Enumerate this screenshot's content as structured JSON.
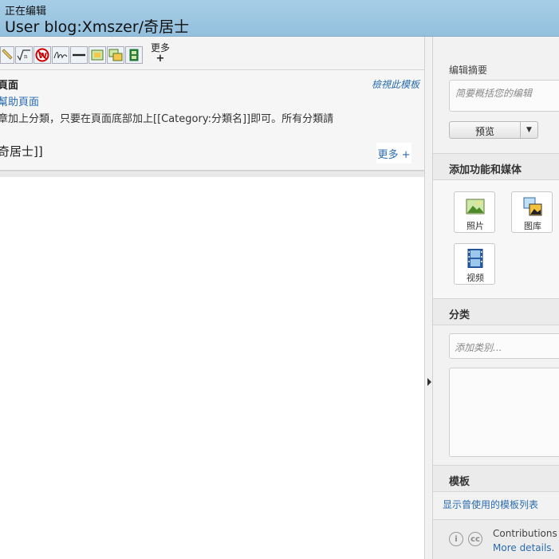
{
  "header": {
    "status": "正在编辑",
    "title": "User blog:Xmszer/奇居士"
  },
  "toolbar": {
    "buttons": [
      "pencil-icon",
      "math-formula-icon",
      "no-wiki-icon",
      "signature-icon",
      "horizontal-line-icon",
      "insert-image-icon",
      "insert-gallery-icon",
      "insert-video-icon"
    ],
    "more_label": "更多",
    "more_plus": "+"
  },
  "notice": {
    "title": "頁面",
    "help_link": "幫助頁面",
    "view_template": "檢視此模板",
    "text": "章加上分類，只要在頁面底部加上[[Category:分類名]]即可。所有分類請",
    "more_label": "更多 +"
  },
  "editor": {
    "content": "奇居士]]"
  },
  "sidebar": {
    "summary_label": "编辑摘要",
    "summary_placeholder": "简要概括您的编辑",
    "preview_label": "预览",
    "media_heading": "添加功能和媒体",
    "media_buttons": [
      {
        "label": "照片",
        "icon": "photo-icon"
      },
      {
        "label": "图库",
        "icon": "gallery-icon"
      },
      {
        "label": "视频",
        "icon": "video-icon"
      }
    ],
    "category_heading": "分类",
    "category_placeholder": "添加类别...",
    "templates_heading": "模板",
    "templates_link": "显示曾使用的模板列表",
    "license_text": "Contributions li",
    "license_more": "More details."
  },
  "colors": {
    "header_bg": "#9ec7e3",
    "link": "#2a6cb0",
    "panel_bg": "#f2f2f2"
  }
}
